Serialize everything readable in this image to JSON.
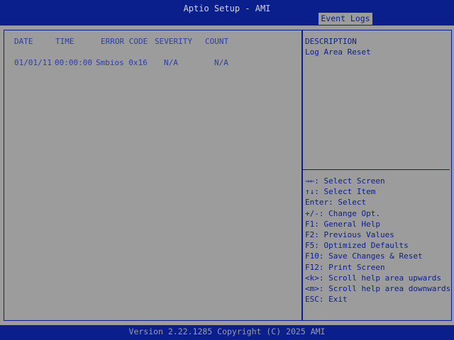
{
  "header": {
    "title": "Aptio Setup - AMI",
    "active_tab": "Event Logs"
  },
  "log_table": {
    "columns": {
      "date": "DATE",
      "time": "TIME",
      "error_code": "ERROR CODE",
      "severity": "SEVERITY",
      "count": "COUNT"
    },
    "rows": [
      {
        "date": "01/01/11",
        "time": "00:00:00",
        "error_code": "Smbios 0x16",
        "severity": "N/A",
        "count": "N/A"
      }
    ]
  },
  "help": {
    "description_title": "DESCRIPTION",
    "description_text": "Log Area Reset",
    "keys": [
      "→←: Select Screen",
      "↑↓: Select Item",
      "Enter: Select",
      "+/-: Change Opt.",
      "F1: General Help",
      "F2: Previous Values",
      "F5: Optimized Defaults",
      "F10: Save Changes & Reset",
      "F12: Print Screen",
      "<k>: Scroll help area upwards",
      "<m>: Scroll help area downwards",
      "ESC: Exit"
    ]
  },
  "footer": {
    "version": "Version 2.22.1285 Copyright (C) 2025 AMI"
  },
  "colors": {
    "bios_blue": "#0b1f8c",
    "panel_gray": "#9c9c9c",
    "title_text": "#d6d6d6",
    "table_text": "#2b3fa6"
  }
}
